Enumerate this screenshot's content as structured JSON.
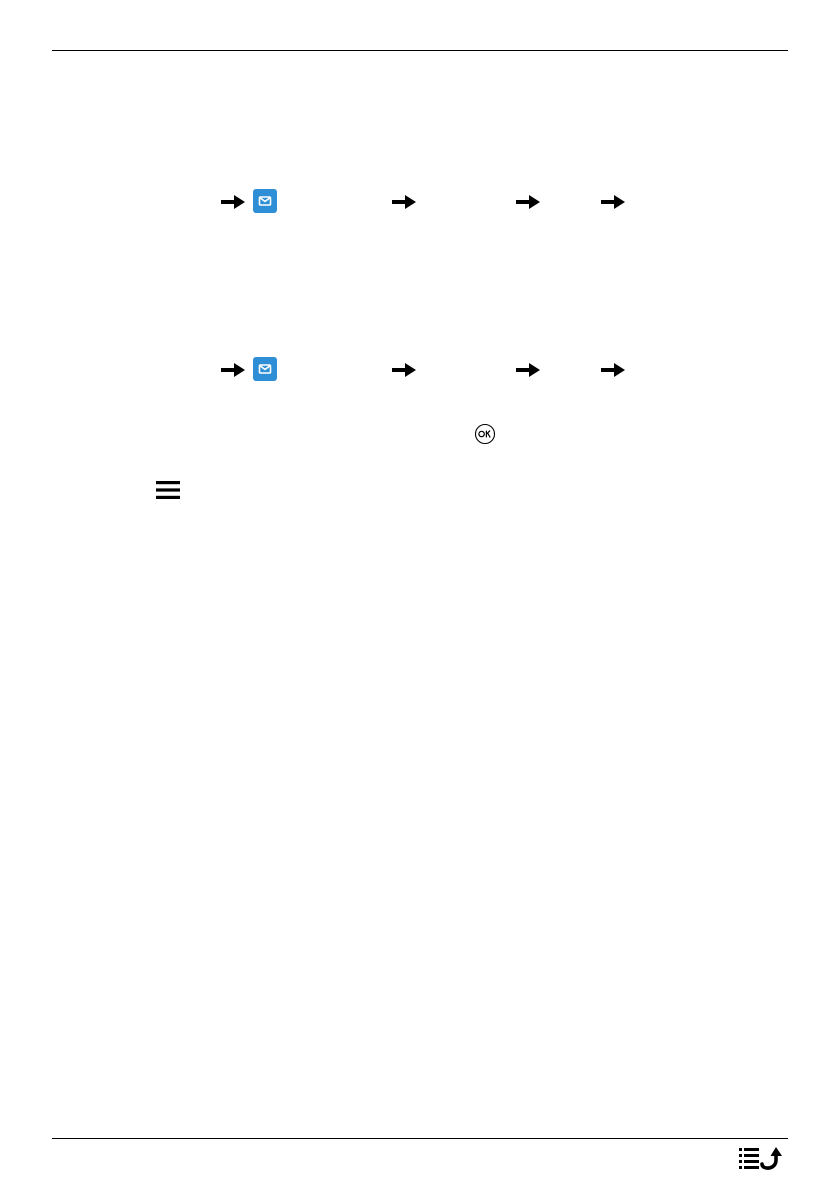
{
  "header": {
    "rule": true
  },
  "footer": {
    "rule": true,
    "index_icon": "table-of-contents-return-icon"
  },
  "instructions": [
    {
      "id": "path-1",
      "icons": [
        "right-arrow-icon",
        "messaging-app-icon",
        "right-arrow-icon",
        "right-arrow-icon",
        "right-arrow-icon"
      ]
    },
    {
      "id": "path-2",
      "icons": [
        "right-arrow-icon",
        "messaging-app-icon",
        "right-arrow-icon",
        "right-arrow-icon",
        "right-arrow-icon"
      ]
    }
  ],
  "inline_icons": [
    "ok-key-icon",
    "menu-icon"
  ],
  "colors": {
    "accent": "#2e8fd6",
    "ink": "#000000",
    "page": "#ffffff"
  }
}
